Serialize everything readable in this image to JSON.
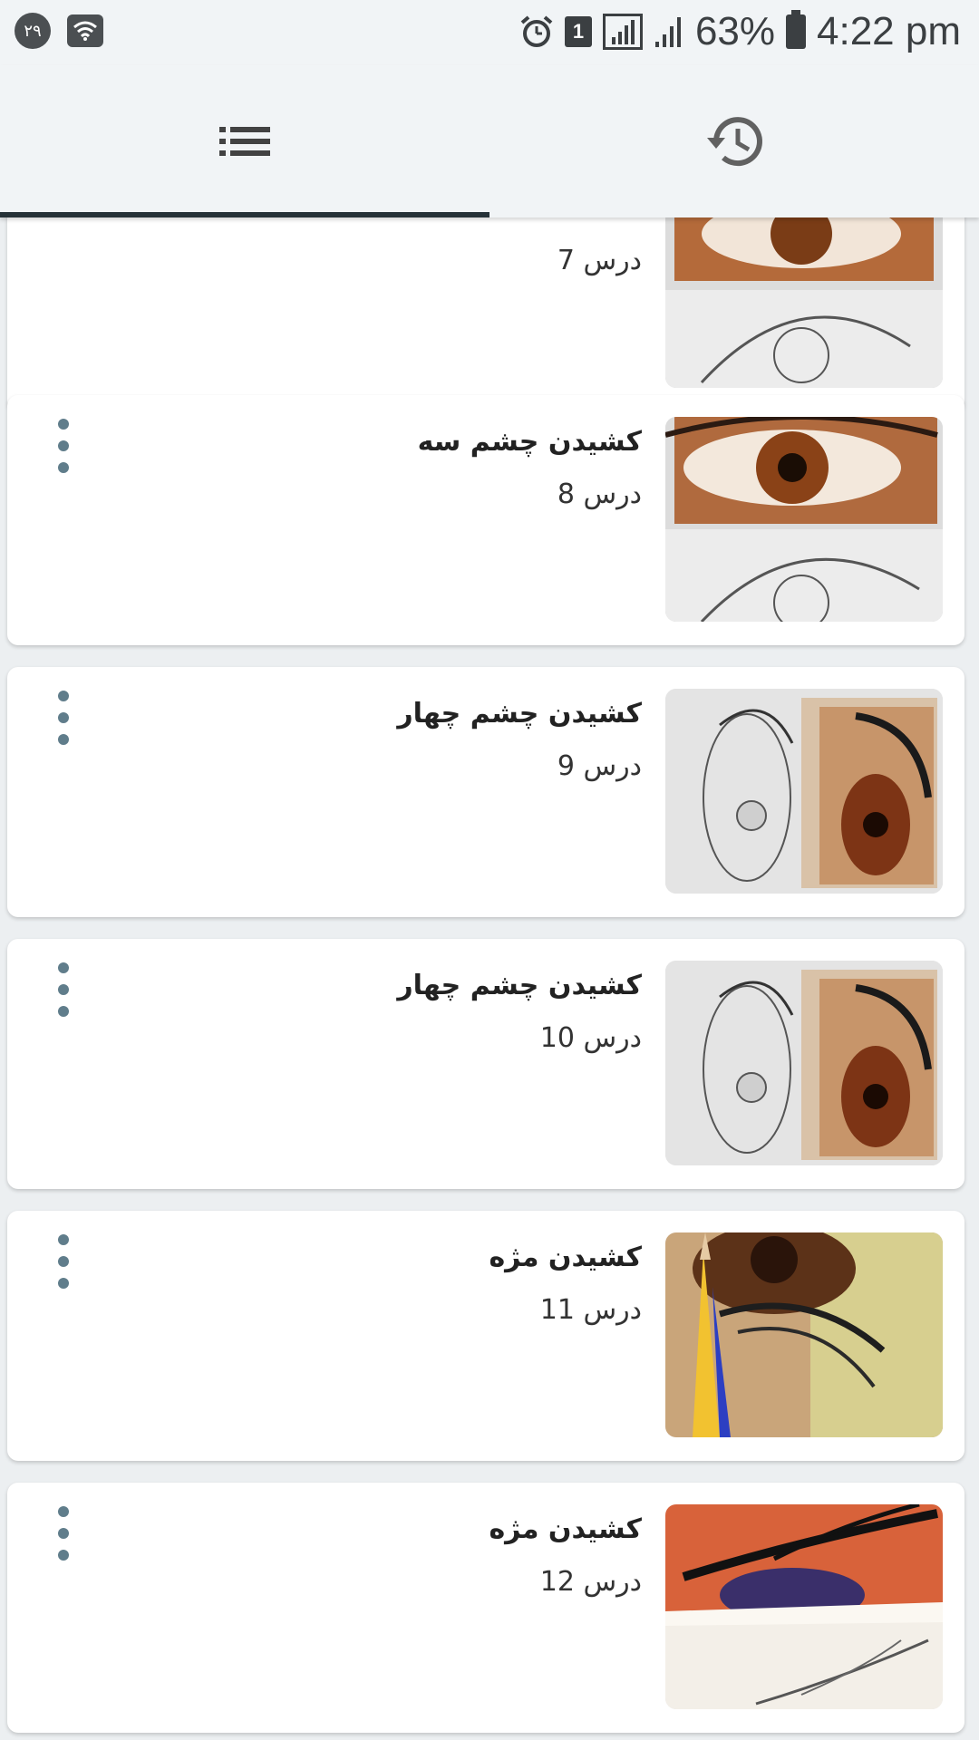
{
  "status_bar": {
    "notif_count": "۲۹",
    "sim_slot": "1",
    "battery": "63%",
    "time": "4:22 pm"
  },
  "tabs": [
    {
      "name": "list",
      "icon": "list-icon"
    },
    {
      "name": "history",
      "icon": "history-icon"
    }
  ],
  "active_tab": "list",
  "lessons": [
    {
      "title": "",
      "subtitle": "درس 7",
      "thumb": "eye-drawing-grid"
    },
    {
      "title": "کشیدن چشم سه",
      "subtitle": "درس 8",
      "thumb": "eye-drawing-grid"
    },
    {
      "title": "کشیدن چشم چهار",
      "subtitle": "درس 9",
      "thumb": "eye-side-sketch"
    },
    {
      "title": "کشیدن چشم چهار",
      "subtitle": "درس 10",
      "thumb": "eye-side-sketch"
    },
    {
      "title": "کشیدن مژه",
      "subtitle": "درس 11",
      "thumb": "eyelash-pencil"
    },
    {
      "title": "کشیدن مژه",
      "subtitle": "درس 12",
      "thumb": "eyelash-closeup"
    }
  ],
  "colors": {
    "background": "#eceff1",
    "bar": "#f1f4f6",
    "indicator": "#263238",
    "menu_dots": "#607d8b"
  }
}
